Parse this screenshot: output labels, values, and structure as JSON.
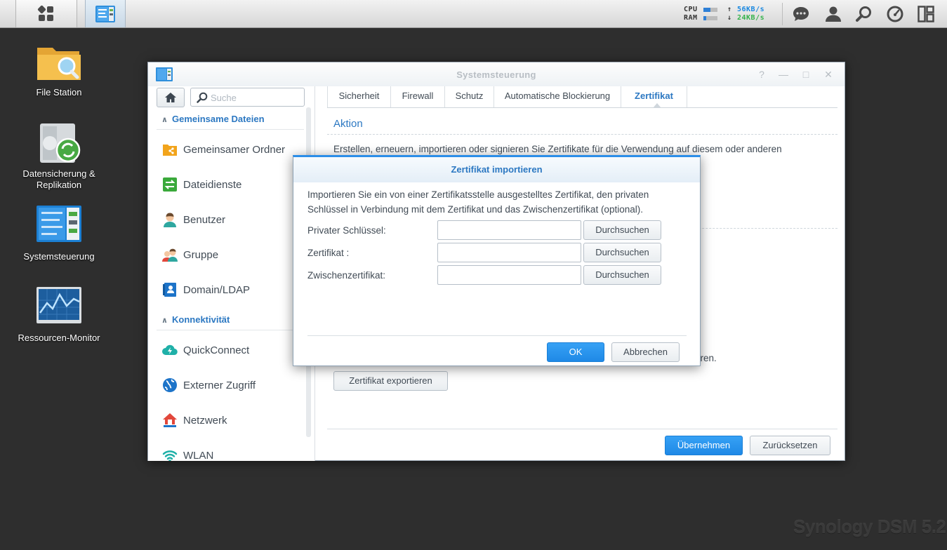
{
  "taskbar": {
    "sysmon": {
      "cpu_label": "CPU",
      "ram_label": "RAM",
      "cpu_level": 0.5,
      "ram_level": 0.2,
      "upload_rate": "56KB/s",
      "download_rate": "24KB/s",
      "upload_color": "#1a88e0",
      "download_color": "#33b24a"
    }
  },
  "desktop": {
    "icons": [
      {
        "label": "File Station"
      },
      {
        "label": "Datensicherung & Replikation"
      },
      {
        "label": "Systemsteuerung"
      },
      {
        "label": "Ressourcen-Monitor"
      }
    ]
  },
  "window": {
    "title": "Systemsteuerung",
    "search_placeholder": "Suche",
    "sidebar": {
      "categories": [
        {
          "label": "Gemeinsame Dateien"
        },
        {
          "label": "Konnektivität"
        }
      ],
      "items": [
        {
          "label": "Gemeinsamer Ordner",
          "icon": "shared-folder-icon"
        },
        {
          "label": "Dateidienste",
          "icon": "file-services-icon"
        },
        {
          "label": "Benutzer",
          "icon": "user-icon"
        },
        {
          "label": "Gruppe",
          "icon": "group-icon"
        },
        {
          "label": "Domain/LDAP",
          "icon": "domain-ldap-icon"
        },
        {
          "label": "QuickConnect",
          "icon": "quickconnect-icon"
        },
        {
          "label": "Externer Zugriff",
          "icon": "globe-icon"
        },
        {
          "label": "Netzwerk",
          "icon": "network-house-icon"
        },
        {
          "label": "WLAN",
          "icon": "wifi-icon"
        }
      ]
    },
    "tabs": [
      {
        "label": "Sicherheit"
      },
      {
        "label": "Firewall"
      },
      {
        "label": "Schutz"
      },
      {
        "label": "Automatische Blockierung"
      },
      {
        "label": "Zertifikat",
        "active": true
      }
    ],
    "section_title": "Aktion",
    "description": "Erstellen, erneuern, importieren oder signieren Sie Zertifikate für die Verwendung auf diesem oder anderen",
    "description_tail": "eren.",
    "export_button": "Zertifikat exportieren",
    "apply_button": "Übernehmen",
    "reset_button": "Zurücksetzen"
  },
  "modal": {
    "title": "Zertifikat importieren",
    "text": "Importieren Sie ein von einer Zertifikatsstelle ausgestelltes Zertifikat, den privaten Schlüssel in Verbindung mit dem Zertifikat und das Zwischenzertifikat (optional).",
    "rows": [
      {
        "label": "Privater Schlüssel:",
        "value": "",
        "button": "Durchsuchen"
      },
      {
        "label": "Zertifikat :",
        "value": "",
        "button": "Durchsuchen"
      },
      {
        "label": "Zwischenzertifikat:",
        "value": "",
        "button": "Durchsuchen"
      }
    ],
    "ok_button": "OK",
    "cancel_button": "Abbrechen"
  },
  "watermark": "Synology DSM 5.2",
  "colors": {
    "accent": "#2c78c2",
    "primary_button": "#1f89e6",
    "desktop_bg": "#2e2e2e"
  }
}
